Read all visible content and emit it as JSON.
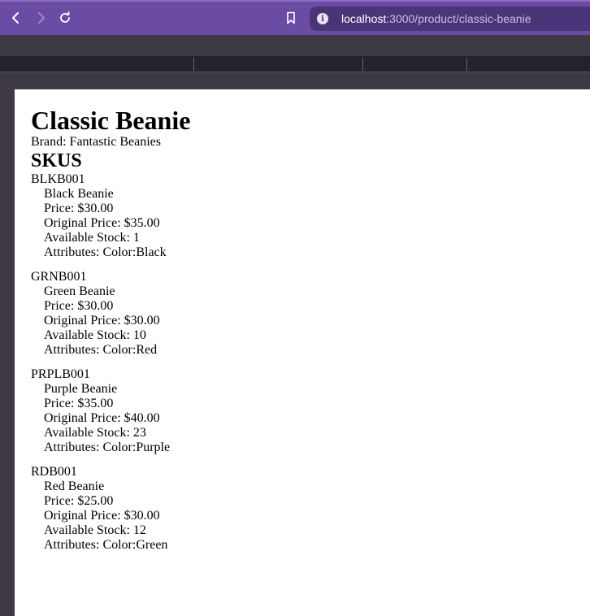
{
  "browser": {
    "url_host": "localhost",
    "url_path": ":3000/product/classic-beanie"
  },
  "product": {
    "title": "Classic Beanie",
    "brand": "Brand: Fantastic Beanies",
    "skus_heading": "SKUS",
    "skus": [
      {
        "code": "BLKB001",
        "name": "Black Beanie",
        "price": "Price: $30.00",
        "original_price": "Original Price: $35.00",
        "stock": "Available Stock: 1",
        "attributes": "Attributes: Color:Black"
      },
      {
        "code": "GRNB001",
        "name": "Green Beanie",
        "price": "Price: $30.00",
        "original_price": "Original Price: $30.00",
        "stock": "Available Stock: 10",
        "attributes": "Attributes: Color:Red"
      },
      {
        "code": "PRPLB001",
        "name": "Purple Beanie",
        "price": "Price: $35.00",
        "original_price": "Original Price: $40.00",
        "stock": "Available Stock: 23",
        "attributes": "Attributes: Color:Purple"
      },
      {
        "code": "RDB001",
        "name": "Red Beanie",
        "price": "Price: $25.00",
        "original_price": "Original Price: $30.00",
        "stock": "Available Stock: 12",
        "attributes": "Attributes: Color:Green"
      }
    ]
  }
}
